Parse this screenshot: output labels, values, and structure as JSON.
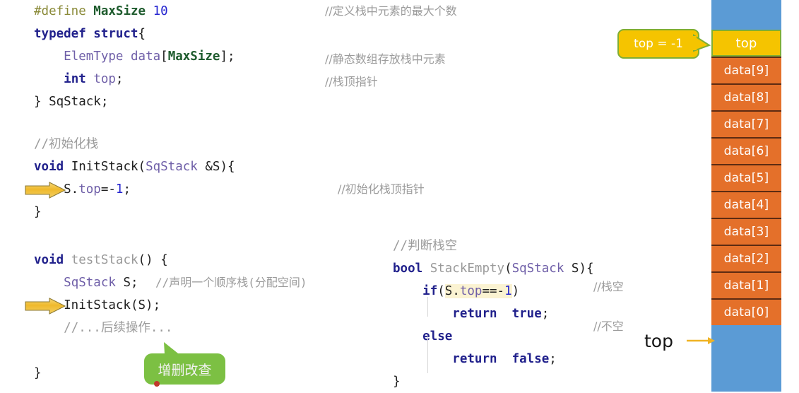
{
  "code_blocks": {
    "struct_def": [
      {
        "segs": [
          {
            "t": "#define ",
            "c": "pre"
          },
          {
            "t": "MaxSize",
            "c": "macro"
          },
          {
            "t": " ",
            "c": "plain"
          },
          {
            "t": "10",
            "c": "num"
          }
        ]
      },
      {
        "segs": [
          {
            "t": "typedef struct",
            "c": "kw"
          },
          {
            "t": "{",
            "c": "plain"
          }
        ]
      },
      {
        "segs": [
          {
            "t": "    ",
            "c": "plain"
          },
          {
            "t": "ElemType",
            "c": "type"
          },
          {
            "t": " ",
            "c": "plain"
          },
          {
            "t": "data",
            "c": "type"
          },
          {
            "t": "[",
            "c": "plain"
          },
          {
            "t": "MaxSize",
            "c": "macro"
          },
          {
            "t": "];",
            "c": "plain"
          }
        ]
      },
      {
        "segs": [
          {
            "t": "    ",
            "c": "plain"
          },
          {
            "t": "int",
            "c": "kw"
          },
          {
            "t": " ",
            "c": "plain"
          },
          {
            "t": "top",
            "c": "type"
          },
          {
            "t": ";",
            "c": "plain"
          }
        ]
      },
      {
        "segs": [
          {
            "t": "} SqStack;",
            "c": "plain"
          }
        ]
      }
    ],
    "init_stack": [
      {
        "segs": [
          {
            "t": "//初始化栈",
            "c": "cmt"
          }
        ]
      },
      {
        "segs": [
          {
            "t": "void",
            "c": "kw"
          },
          {
            "t": " ",
            "c": "plain"
          },
          {
            "t": "InitStack",
            "c": "plain"
          },
          {
            "t": "(",
            "c": "plain"
          },
          {
            "t": "SqStack",
            "c": "type"
          },
          {
            "t": " &S){",
            "c": "plain"
          }
        ]
      },
      {
        "segs": [
          {
            "t": "    S.",
            "c": "plain"
          },
          {
            "t": "top",
            "c": "type"
          },
          {
            "t": "=",
            "c": "plain"
          },
          {
            "t": "-",
            "c": "plain"
          },
          {
            "t": "1",
            "c": "num"
          },
          {
            "t": ";",
            "c": "plain"
          }
        ]
      },
      {
        "segs": [
          {
            "t": "}",
            "c": "plain"
          }
        ]
      }
    ],
    "test_stack": [
      {
        "segs": [
          {
            "t": "void",
            "c": "kw"
          },
          {
            "t": " ",
            "c": "plain"
          },
          {
            "t": "testStack",
            "c": "fn"
          },
          {
            "t": "() {",
            "c": "plain"
          }
        ]
      },
      {
        "segs": [
          {
            "t": "    ",
            "c": "plain"
          },
          {
            "t": "SqStack",
            "c": "type"
          },
          {
            "t": " S;",
            "c": "plain"
          }
        ]
      },
      {
        "segs": [
          {
            "t": "    InitStack(S);",
            "c": "plain"
          }
        ]
      },
      {
        "segs": [
          {
            "t": "    ",
            "c": "plain"
          },
          {
            "t": "//...后续操作...",
            "c": "cmt"
          }
        ]
      },
      {
        "segs": [
          {
            "t": "",
            "c": "plain"
          }
        ]
      },
      {
        "segs": [
          {
            "t": "}",
            "c": "plain"
          }
        ]
      }
    ],
    "stack_empty": [
      {
        "segs": [
          {
            "t": "//判断栈空",
            "c": "cmt"
          }
        ]
      },
      {
        "segs": [
          {
            "t": "bool",
            "c": "kw"
          },
          {
            "t": " ",
            "c": "plain"
          },
          {
            "t": "StackEmpty",
            "c": "fn"
          },
          {
            "t": "(",
            "c": "plain"
          },
          {
            "t": "SqStack",
            "c": "type"
          },
          {
            "t": " S){",
            "c": "plain"
          }
        ]
      },
      {
        "segs": [
          {
            "t": "    ",
            "c": "plain"
          },
          {
            "t": "if",
            "c": "kw"
          },
          {
            "t": "(",
            "c": "plain"
          },
          {
            "t": "S.",
            "c": "hl plain"
          },
          {
            "t": "top",
            "c": "hl type"
          },
          {
            "t": "==",
            "c": "hl plain"
          },
          {
            "t": "-",
            "c": "hl plain"
          },
          {
            "t": "1",
            "c": "hl num"
          },
          {
            "t": ")",
            "c": "plain"
          }
        ]
      },
      {
        "segs": [
          {
            "t": "        ",
            "c": "plain"
          },
          {
            "t": "return",
            "c": "kw"
          },
          {
            "t": "  ",
            "c": "plain"
          },
          {
            "t": "true",
            "c": "kw"
          },
          {
            "t": ";",
            "c": "plain"
          }
        ]
      },
      {
        "segs": [
          {
            "t": "    ",
            "c": "plain"
          },
          {
            "t": "else",
            "c": "kw"
          }
        ]
      },
      {
        "segs": [
          {
            "t": "        ",
            "c": "plain"
          },
          {
            "t": "return",
            "c": "kw"
          },
          {
            "t": "  ",
            "c": "plain"
          },
          {
            "t": "false",
            "c": "kw"
          },
          {
            "t": ";",
            "c": "plain"
          }
        ]
      },
      {
        "segs": [
          {
            "t": "}",
            "c": "plain"
          }
        ]
      }
    ]
  },
  "comments": {
    "max_size": "//定义栈中元素的最大个数",
    "static_array": "//静态数组存放栈中元素",
    "top_pointer": "//栈顶指针",
    "init_top_pointer": "//初始化栈顶指针",
    "declare_stack": "//声明一个顺序栈(分配空间)",
    "stack_empty_label": "//栈空",
    "stack_not_empty_label": "//不空"
  },
  "callouts": {
    "top_value": "top = -1",
    "crud": "增删改查"
  },
  "stack_diagram": {
    "top_label": "top",
    "pointer_label": "top",
    "cells": [
      "data[9]",
      "data[8]",
      "data[7]",
      "data[6]",
      "data[5]",
      "data[4]",
      "data[3]",
      "data[2]",
      "data[1]",
      "data[0]"
    ]
  },
  "colors": {
    "orange": "#e4702a",
    "blue": "#5b9bd5",
    "yellow": "#f5c400",
    "green_border": "#7fae34",
    "green_callout": "#7cc043",
    "arrow": "#f0b323",
    "highlight": "#fbf3d2"
  }
}
